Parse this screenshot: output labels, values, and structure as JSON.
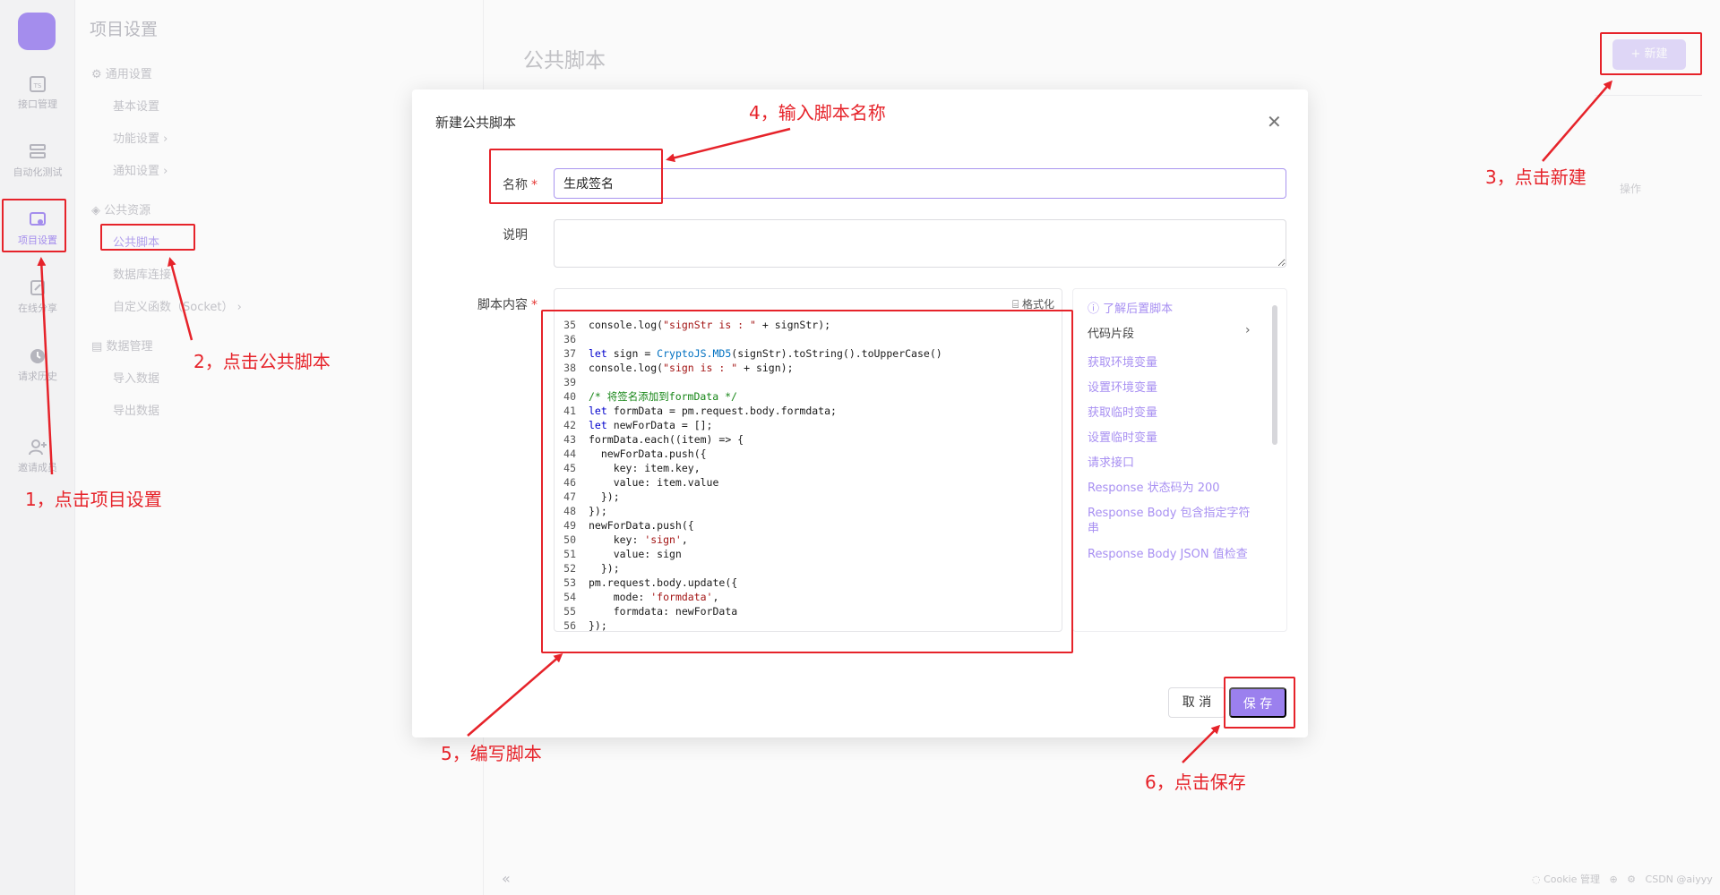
{
  "sidebar": {
    "items": [
      {
        "label": "接口管理",
        "icon": "api-doc-icon"
      },
      {
        "label": "自动化测试",
        "icon": "automation-icon"
      },
      {
        "label": "项目设置",
        "icon": "settings-icon"
      },
      {
        "label": "在线分享",
        "icon": "share-icon"
      },
      {
        "label": "请求历史",
        "icon": "history-icon"
      },
      {
        "label": "邀请成员",
        "icon": "invite-user-icon"
      }
    ]
  },
  "settings_nav": {
    "title": "项目设置",
    "groups": [
      {
        "label": "通用设置",
        "items": [
          "基本设置",
          "功能设置",
          "通知设置"
        ]
      },
      {
        "label": "公共资源",
        "items": [
          "公共脚本",
          "数据库连接",
          "自定义函数（Socket）"
        ]
      },
      {
        "label": "数据管理",
        "items": [
          "导入数据",
          "导出数据"
        ]
      }
    ]
  },
  "main": {
    "title": "公共脚本",
    "new_button": "+ 新建",
    "column_op": "操作",
    "footer": "Cookie 管理"
  },
  "modal": {
    "title": "新建公共脚本",
    "name_label": "名称",
    "name_value": "生成签名",
    "desc_label": "说明",
    "script_label": "脚本内容",
    "format_label": "格式化",
    "snippets": {
      "learn": "了解后置脚本",
      "section": "代码片段",
      "items": [
        "获取环境变量",
        "设置环境变量",
        "获取临时变量",
        "设置临时变量",
        "请求接口",
        "Response 状态码为 200",
        "Response Body 包含指定字符串",
        "Response Body JSON 值检查"
      ]
    },
    "cancel": "取 消",
    "save": "保 存"
  },
  "annotations": [
    "1，点击项目设置",
    "2，点击公共脚本",
    "3，点击新建",
    "4，输入脚本名称",
    "5，编写脚本",
    "6，点击保存"
  ],
  "watermark": "CSDN @aiyyy",
  "colors": {
    "accent": "#9b80ee",
    "annotation": "#e6232a"
  }
}
